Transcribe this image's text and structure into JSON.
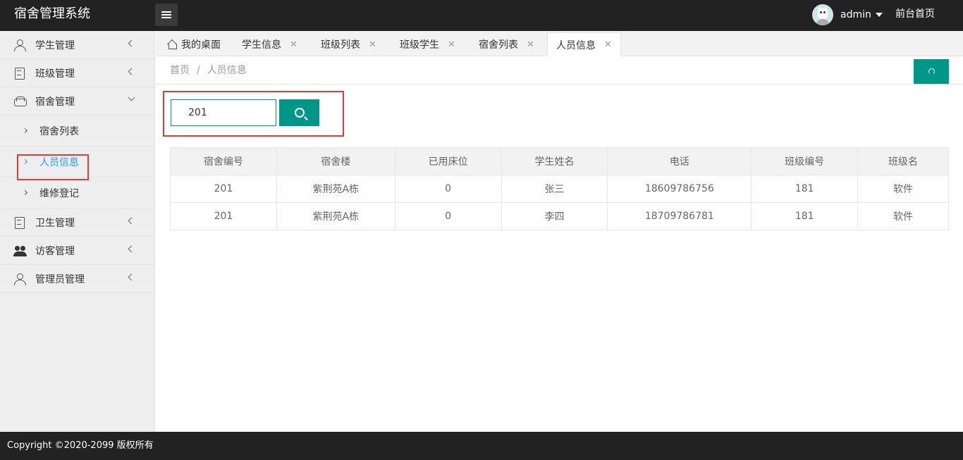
{
  "app": {
    "title": "宿舍管理系统",
    "user_name": "admin",
    "front_link": "前台首页"
  },
  "sidebar": {
    "items": [
      {
        "label": "学生管理",
        "icon": "user-icon",
        "expanded": false
      },
      {
        "label": "班级管理",
        "icon": "document-icon",
        "expanded": false
      },
      {
        "label": "宿舍管理",
        "icon": "sofa-icon",
        "expanded": true
      },
      {
        "label": "卫生管理",
        "icon": "document-icon",
        "expanded": false
      },
      {
        "label": "访客管理",
        "icon": "people-icon",
        "expanded": false
      },
      {
        "label": "管理员管理",
        "icon": "user-icon",
        "expanded": false
      }
    ],
    "sub_items": [
      {
        "label": "宿舍列表",
        "active": false
      },
      {
        "label": "人员信息",
        "active": true
      },
      {
        "label": "维修登记",
        "active": false
      }
    ]
  },
  "tabs": [
    {
      "label": "我的桌面",
      "closable": false
    },
    {
      "label": "学生信息",
      "closable": true
    },
    {
      "label": "班级列表",
      "closable": true
    },
    {
      "label": "班级学生",
      "closable": true
    },
    {
      "label": "宿舍列表",
      "closable": true
    },
    {
      "label": "人员信息",
      "closable": true,
      "active": true
    }
  ],
  "tab_close_glyph": "✕",
  "breadcrumb": {
    "home": "首页",
    "separator": "/",
    "current": "人员信息"
  },
  "search": {
    "value": "201",
    "placeholder": ""
  },
  "table": {
    "headers": [
      "宿舍编号",
      "宿舍楼",
      "已用床位",
      "学生姓名",
      "电话",
      "班级编号",
      "班级名"
    ],
    "rows": [
      [
        "201",
        "紫荆苑A栋",
        "0",
        "张三",
        "18609786756",
        "181",
        "软件"
      ],
      [
        "201",
        "紫荆苑A栋",
        "0",
        "李四",
        "18709786781",
        "181",
        "软件"
      ]
    ]
  },
  "footer": {
    "copyright": "Copyright ©2020-2099 版权所有"
  },
  "colors": {
    "accent": "#009688",
    "active_link": "#1e9fff",
    "highlight": "#e53935",
    "header_bg": "#222222"
  }
}
